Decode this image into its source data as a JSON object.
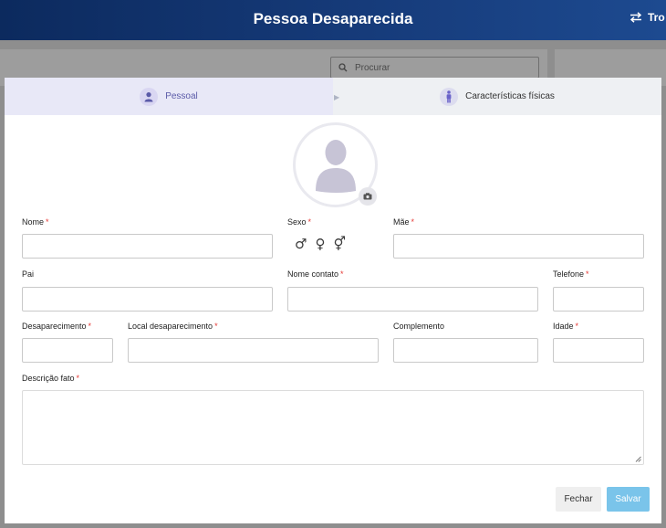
{
  "app": {
    "title": "Pessoa Desaparecida",
    "switch_label": "Tro"
  },
  "background": {
    "search_placeholder": "Procurar"
  },
  "tabs": [
    {
      "label": "Pessoal",
      "icon": "user-icon"
    },
    {
      "label": "Características físicas",
      "icon": "person-standing-icon"
    }
  ],
  "avatar": {
    "icon": "user-placeholder-icon",
    "action_icon": "camera-icon"
  },
  "form": {
    "nome": {
      "label": "Nome",
      "required": "*",
      "value": ""
    },
    "sexo": {
      "label": "Sexo",
      "required": "*",
      "options": [
        "♂",
        "♀",
        "⚥"
      ]
    },
    "mae": {
      "label": "Mãe",
      "required": "*",
      "value": ""
    },
    "pai": {
      "label": "Pai",
      "value": ""
    },
    "nome_contato": {
      "label": "Nome contato",
      "required": "*",
      "value": ""
    },
    "telefone": {
      "label": "Telefone",
      "required": "*",
      "value": ""
    },
    "desaparecimento": {
      "label": "Desaparecimento",
      "required": "*",
      "value": ""
    },
    "local_desaparecimento": {
      "label": "Local desaparecimento",
      "required": "*",
      "value": ""
    },
    "complemento": {
      "label": "Complemento",
      "value": ""
    },
    "idade": {
      "label": "Idade",
      "required": "*",
      "value": ""
    },
    "descricao_fato": {
      "label": "Descrição fato",
      "required": "*",
      "value": ""
    }
  },
  "actions": {
    "close_label": "Fechar",
    "save_label": "Salvar"
  },
  "colors": {
    "primary": "#163b7a",
    "accent": "#5a5aa8",
    "required": "#e53935",
    "save": "#7ac4ea"
  }
}
